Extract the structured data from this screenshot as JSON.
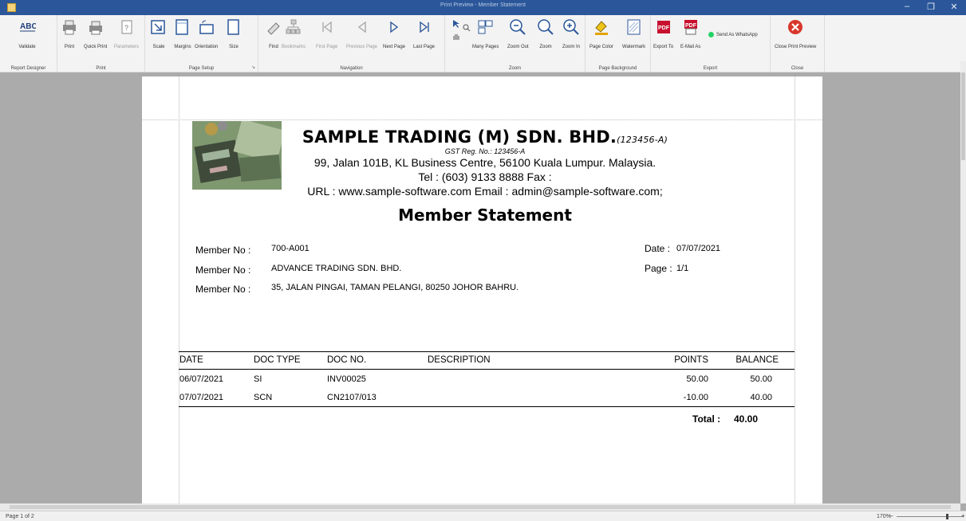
{
  "window": {
    "title": "Print Preview - Member Statement",
    "controls": [
      "–",
      "❐",
      "✕"
    ]
  },
  "ribbon": {
    "groups": [
      {
        "label": "Report Designer",
        "buttons": [
          {
            "label": "Validate",
            "icon": "abc-validate-icon"
          }
        ]
      },
      {
        "label": "Print",
        "buttons": [
          {
            "label": "Print",
            "icon": "printer-icon"
          },
          {
            "label": "Quick Print",
            "icon": "quick-print-icon"
          },
          {
            "label": "Parameters",
            "icon": "parameters-icon",
            "disabled": true
          }
        ]
      },
      {
        "label": "Page Setup",
        "buttons": [
          {
            "label": "Scale",
            "icon": "scale-icon"
          },
          {
            "label": "Margins",
            "icon": "margins-icon"
          },
          {
            "label": "Orientation",
            "icon": "orientation-icon"
          },
          {
            "label": "Size",
            "icon": "page-size-icon"
          }
        ]
      },
      {
        "label": "Navigation",
        "buttons": [
          {
            "label": "Find",
            "icon": "find-icon"
          },
          {
            "label": "Bookmarks",
            "icon": "bookmarks-icon",
            "disabled": true
          },
          {
            "label": "First Page",
            "icon": "first-page-icon",
            "disabled": true
          },
          {
            "label": "Previous Page",
            "icon": "previous-page-icon",
            "disabled": true
          },
          {
            "label": "Next Page",
            "icon": "next-page-icon"
          },
          {
            "label": "Last Page",
            "icon": "last-page-icon"
          }
        ]
      },
      {
        "label": "Zoom",
        "buttons": [
          {
            "label": "Many Pages",
            "icon": "many-pages-icon"
          },
          {
            "label": "Zoom Out",
            "icon": "zoom-out-icon"
          },
          {
            "label": "Zoom",
            "icon": "zoom-icon"
          },
          {
            "label": "Zoom In",
            "icon": "zoom-in-icon"
          }
        ]
      },
      {
        "label": "Page Background",
        "buttons": [
          {
            "label": "Page Color",
            "icon": "page-color-icon"
          },
          {
            "label": "Watermark",
            "icon": "watermark-icon"
          }
        ]
      },
      {
        "label": "Export",
        "buttons": [
          {
            "label": "Export To",
            "icon": "pdf-export-icon"
          },
          {
            "label": "E-Mail As",
            "icon": "pdf-email-icon"
          },
          {
            "label": "Send As WhatsApp",
            "icon": "whatsapp-icon"
          }
        ]
      },
      {
        "label": "Close",
        "buttons": [
          {
            "label": "Close Print Preview",
            "icon": "close-preview-icon"
          }
        ]
      }
    ]
  },
  "report": {
    "company_name": "SAMPLE TRADING (M) SDN. BHD.",
    "company_reg": "(123456-A)",
    "gst": "GST Reg. No.: 123456-A",
    "address": "99, Jalan 101B,  KL Business Centre, 56100 Kuala Lumpur. Malaysia.",
    "phone": "Tel : (603) 9133 8888  Fax :",
    "web": "URL : www.sample-software.com    Email : admin@sample-software.com;",
    "title": "Member Statement",
    "member_label_1": "Member No :",
    "member_label_2": "Member No :",
    "member_label_3": "Member No :",
    "member_no": "700-A001",
    "member_name": "ADVANCE TRADING SDN. BHD.",
    "member_address": "35, JALAN PINGAI, TAMAN PELANGI, 80250 JOHOR BAHRU.",
    "date_label": "Date :",
    "date_value": "07/07/2021",
    "page_label": "Page :",
    "page_value": "1/1",
    "columns": {
      "date": "DATE",
      "doc_type": "DOC TYPE",
      "doc_no": "DOC NO.",
      "description": "DESCRIPTION",
      "points": "POINTS",
      "balance": "BALANCE"
    },
    "rows": [
      {
        "date": "06/07/2021",
        "doc_type": "SI",
        "doc_no": "INV00025",
        "description": "",
        "points": "50.00",
        "balance": "50.00"
      },
      {
        "date": "07/07/2021",
        "doc_type": "SCN",
        "doc_no": "CN2107/013",
        "description": "",
        "points": "-10.00",
        "balance": "40.00"
      }
    ],
    "total_label": "Total :",
    "total_value": "40.00"
  },
  "status": {
    "page_info": "Page 1 of 2",
    "zoom": "170%",
    "zoom_minus": "–",
    "zoom_plus": "+"
  },
  "colors": {
    "titlebar": "#2b579a",
    "ribbon": "#f3f3f3",
    "workspace": "#ababab"
  }
}
